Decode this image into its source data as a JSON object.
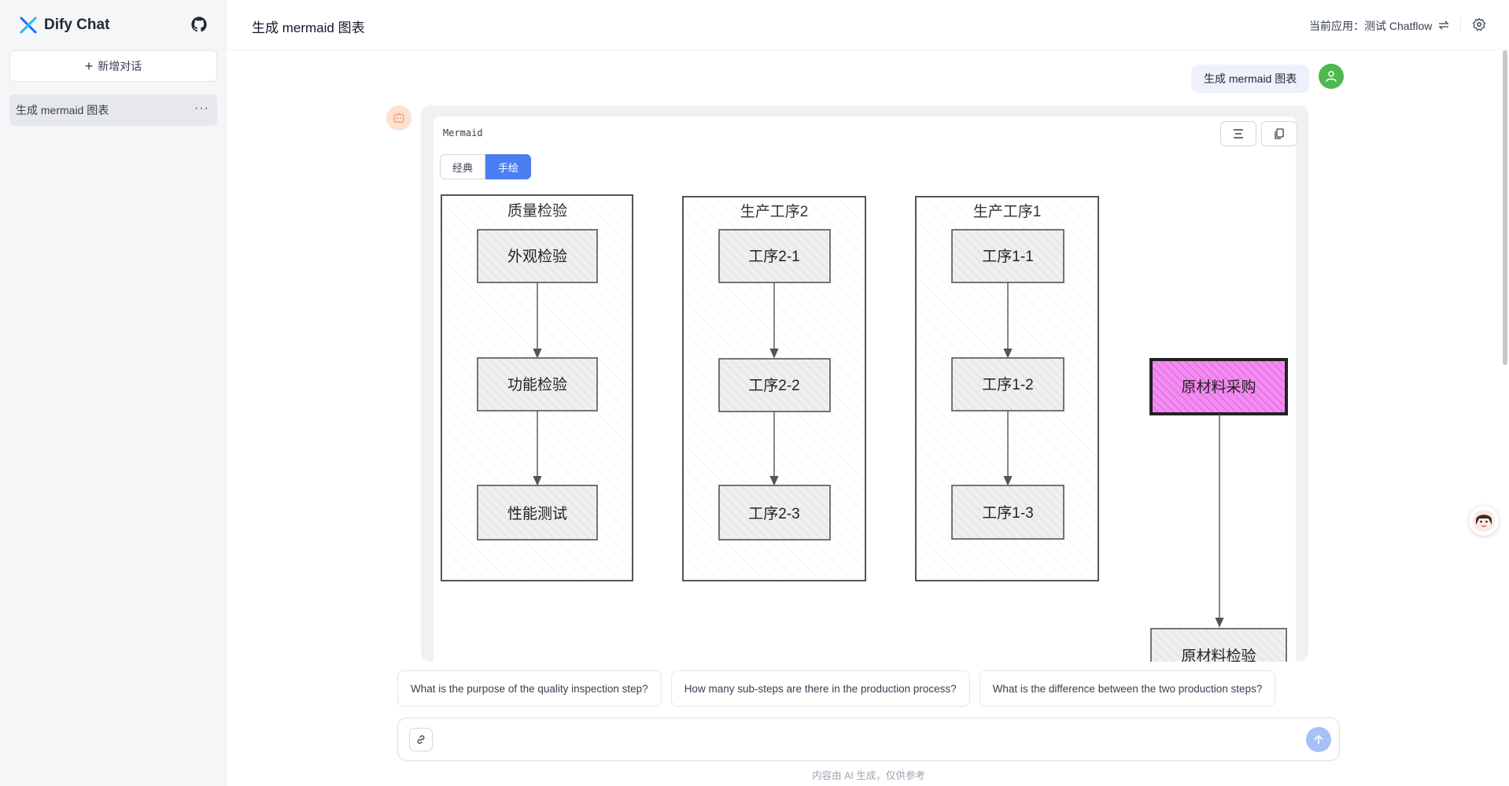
{
  "sidebar": {
    "brand": "Dify Chat",
    "new_chat_label": "新增对话",
    "conversations": [
      {
        "label": "生成 mermaid 图表"
      }
    ]
  },
  "header": {
    "title": "生成 mermaid 图表",
    "current_app_label": "当前应用：",
    "current_app_name": "测试 Chatflow"
  },
  "messages": {
    "user_text": "生成 mermaid 图表"
  },
  "mermaid": {
    "label": "Mermaid",
    "tabs": {
      "classic": "经典",
      "hand": "手绘"
    },
    "active_tab": "hand",
    "subgraphs": [
      {
        "title": "质量检验",
        "nodes": [
          "外观检验",
          "功能检验",
          "性能测试"
        ]
      },
      {
        "title": "生产工序2",
        "nodes": [
          "工序2-1",
          "工序2-2",
          "工序2-3"
        ]
      },
      {
        "title": "生产工序1",
        "nodes": [
          "工序1-1",
          "工序1-2",
          "工序1-3"
        ]
      }
    ],
    "highlight_node": "原材料采购",
    "partial_node": "原材料检验",
    "colors": {
      "highlight_fill": "#ee82ee",
      "node_fill": "#ececec",
      "stroke": "#555555"
    }
  },
  "suggestions": [
    "What is the purpose of the quality inspection step?",
    "How many sub-steps are there in the production process?",
    "What is the difference between the two production steps?"
  ],
  "input": {
    "placeholder": ""
  },
  "disclaimer": "内容由 AI 生成，仅供参考",
  "colors": {
    "accent": "#4c7ef3",
    "send_disabled": "#a8c0f7",
    "user_avatar": "#4cb84f"
  }
}
